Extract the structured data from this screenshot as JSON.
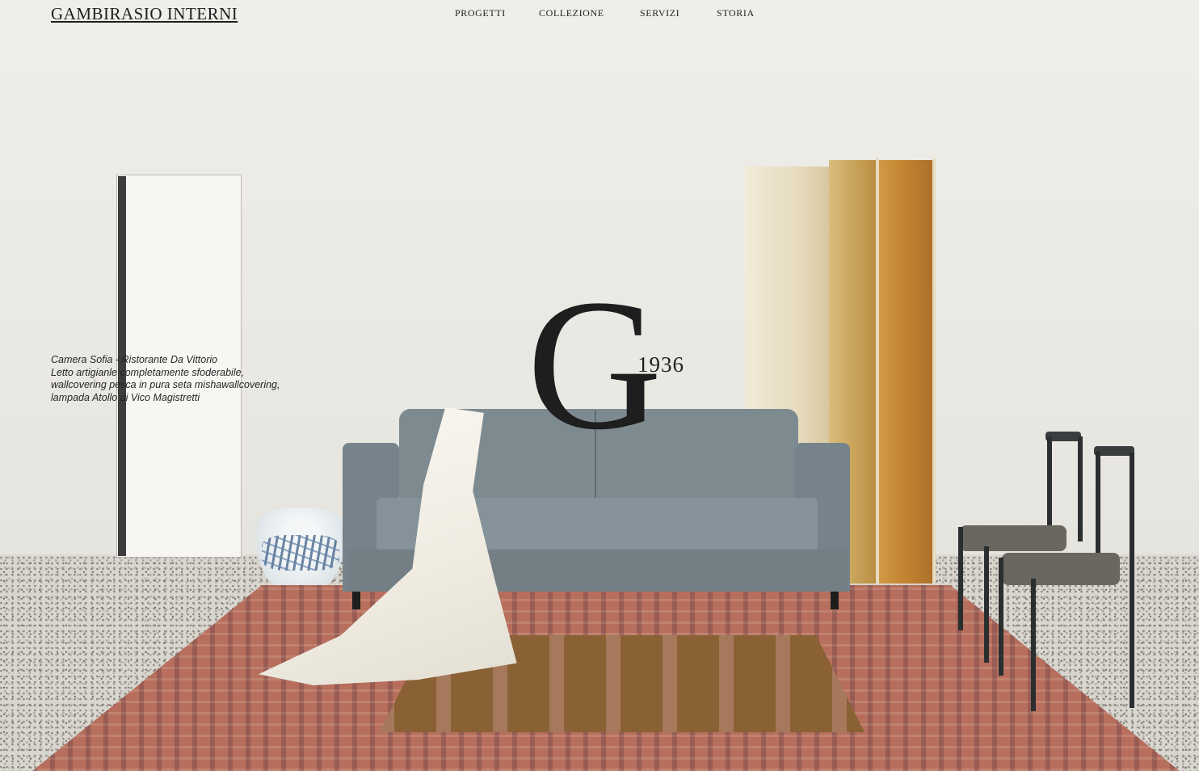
{
  "header": {
    "logo": "GAMBIRASIO INTERNI",
    "nav": [
      {
        "label": "PROGETTI"
      },
      {
        "label": "COLLEZIONE"
      },
      {
        "label": "SERVIZI"
      },
      {
        "label": "STORIA"
      }
    ]
  },
  "brand_mark": {
    "letter": "G",
    "year": "1936"
  },
  "caption": {
    "lines": [
      "Camera Sofia - Ristorante Da Vittorio",
      "Letto artigianle completamente sfoderabile,",
      "wallcovering pesca in pura seta mishawallcovering,",
      "lampada Atollo di Vico Magistretti"
    ]
  },
  "colors": {
    "text": "#1f1f1f",
    "wall": "#ecebe6",
    "sofa": "#7d8a90",
    "rug": "#b76e5c",
    "screen_gold": "#c2812f"
  }
}
